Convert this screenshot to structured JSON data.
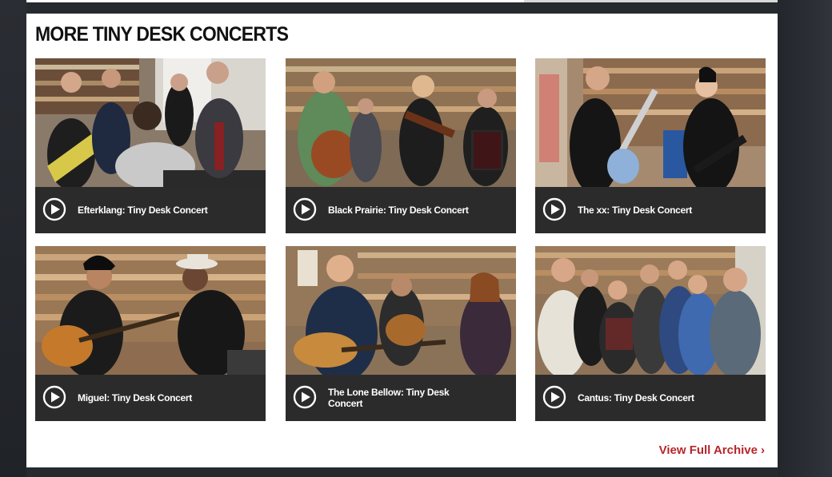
{
  "section": {
    "title": "MORE TINY DESK CONCERTS",
    "archive_link": "View Full Archive",
    "archive_chevron": "›"
  },
  "concerts": [
    {
      "caption": "Efterklang: Tiny Desk Concert",
      "icon": "play-icon"
    },
    {
      "caption": "Black Prairie: Tiny Desk Concert",
      "icon": "play-icon"
    },
    {
      "caption": "The xx: Tiny Desk Concert",
      "icon": "play-icon"
    },
    {
      "caption": "Miguel: Tiny Desk Concert",
      "icon": "play-icon"
    },
    {
      "caption": "The Lone Bellow: Tiny Desk Concert",
      "icon": "play-icon"
    },
    {
      "caption": "Cantus: Tiny Desk Concert",
      "icon": "play-icon"
    }
  ],
  "colors": {
    "accent": "#b8252b",
    "caption_bg": "#2b2b2b",
    "page_bg": "#26292e"
  }
}
